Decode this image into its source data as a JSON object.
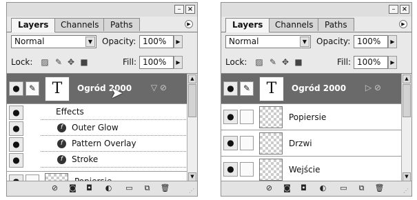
{
  "panels": [
    {
      "tabs": [
        "Layers",
        "Channels",
        "Paths"
      ],
      "blend_mode": "Normal",
      "opacity_label": "Opacity:",
      "opacity_value": "100%",
      "lock_label": "Lock:",
      "fill_label": "Fill:",
      "fill_value": "100%",
      "text_layer": {
        "thumb": "T",
        "name": "Ogród 2000"
      },
      "effects_header": "Effects",
      "effects": [
        "Outer Glow",
        "Pattern Overlay",
        "Stroke"
      ],
      "partial_layer": "Popiersie"
    },
    {
      "tabs": [
        "Layers",
        "Channels",
        "Paths"
      ],
      "blend_mode": "Normal",
      "opacity_label": "Opacity:",
      "opacity_value": "100%",
      "lock_label": "Lock:",
      "fill_label": "Fill:",
      "fill_value": "100%",
      "text_layer": {
        "thumb": "T",
        "name": "Ogród 2000"
      },
      "layers": [
        "Popiersie",
        "Drzwi",
        "Wejście"
      ]
    }
  ]
}
